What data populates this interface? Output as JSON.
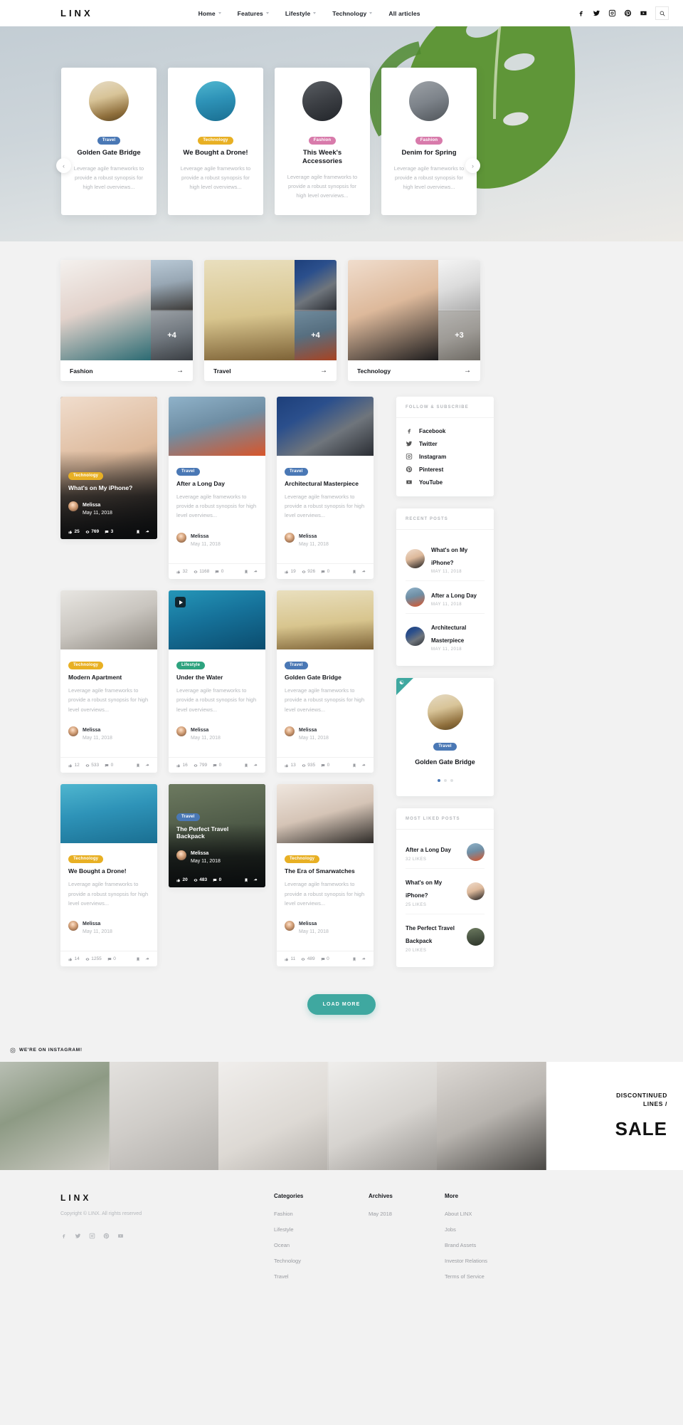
{
  "header": {
    "logo": "LINX",
    "nav": [
      {
        "label": "Home",
        "has_caret": true
      },
      {
        "label": "Features",
        "has_caret": true
      },
      {
        "label": "Lifestyle",
        "has_caret": true
      },
      {
        "label": "Technology",
        "has_caret": true
      },
      {
        "label": "All articles",
        "has_caret": false
      }
    ],
    "social": [
      "facebook-icon",
      "twitter-icon",
      "instagram-icon",
      "pinterest-icon",
      "youtube-icon"
    ],
    "search_icon": "search-icon"
  },
  "hero": {
    "prev_label": "‹",
    "next_label": "›",
    "cards": [
      {
        "tag": "Travel",
        "tag_class": "travel",
        "title": "Golden Gate Bridge",
        "desc": "Leverage agile frameworks to provide a robust synopsis for high level overviews..."
      },
      {
        "tag": "Technology",
        "tag_class": "technology",
        "title": "We Bought a Drone!",
        "desc": "Leverage agile frameworks to provide a robust synopsis for high level overviews..."
      },
      {
        "tag": "Fashion",
        "tag_class": "fashion",
        "title": "This Week's Accessories",
        "desc": "Leverage agile frameworks to provide a robust synopsis for high level overviews..."
      },
      {
        "tag": "Fashion",
        "tag_class": "fashion",
        "title": "Denim for Spring",
        "desc": "Leverage agile frameworks to provide a robust synopsis for high level overviews..."
      }
    ]
  },
  "categories": [
    {
      "name": "Fashion",
      "more": "+4",
      "arrow": "→"
    },
    {
      "name": "Travel",
      "more": "+4",
      "arrow": "→"
    },
    {
      "name": "Technology",
      "more": "+3",
      "arrow": "→"
    }
  ],
  "posts": [
    {
      "tag": "Technology",
      "tag_class": "technology",
      "title": "What's on My iPhone?",
      "desc": "",
      "author": "Melissa",
      "date": "May 11, 2018",
      "likes": "25",
      "views": "769",
      "comments": "3",
      "featured": true
    },
    {
      "tag": "Travel",
      "tag_class": "travel",
      "title": "After a Long Day",
      "desc": "Leverage agile frameworks to provide a robust synopsis for high level overviews...",
      "author": "Melissa",
      "date": "May 11, 2018",
      "likes": "32",
      "views": "1168",
      "comments": "0",
      "featured": false
    },
    {
      "tag": "Travel",
      "tag_class": "travel",
      "title": "Architectural Masterpiece",
      "desc": "Leverage agile frameworks to provide a robust synopsis for high level overviews...",
      "author": "Melissa",
      "date": "May 11, 2018",
      "likes": "19",
      "views": "926",
      "comments": "0",
      "featured": false
    },
    {
      "tag": "Technology",
      "tag_class": "technology",
      "title": "Modern Apartment",
      "desc": "Leverage agile frameworks to provide a robust synopsis for high level overviews...",
      "author": "Melissa",
      "date": "May 11, 2018",
      "likes": "12",
      "views": "533",
      "comments": "0",
      "featured": false
    },
    {
      "tag": "Lifestyle",
      "tag_class": "lifestyle",
      "title": "Under the Water",
      "desc": "Leverage agile frameworks to provide a robust synopsis for high level overviews...",
      "author": "Melissa",
      "date": "May 11, 2018",
      "likes": "16",
      "views": "799",
      "comments": "0",
      "featured": false,
      "video": true
    },
    {
      "tag": "Travel",
      "tag_class": "travel",
      "title": "Golden Gate Bridge",
      "desc": "Leverage agile frameworks to provide a robust synopsis for high level overviews...",
      "author": "Melissa",
      "date": "May 11, 2018",
      "likes": "13",
      "views": "935",
      "comments": "0",
      "featured": false
    },
    {
      "tag": "Technology",
      "tag_class": "technology",
      "title": "We Bought a Drone!",
      "desc": "Leverage agile frameworks to provide a robust synopsis for high level overviews...",
      "author": "Melissa",
      "date": "May 11, 2018",
      "likes": "14",
      "views": "1255",
      "comments": "0",
      "featured": false
    },
    {
      "tag": "Travel",
      "tag_class": "travel",
      "title": "The Perfect Travel Backpack",
      "desc": "",
      "author": "Melissa",
      "date": "May 11, 2018",
      "likes": "20",
      "views": "483",
      "comments": "0",
      "featured": true
    },
    {
      "tag": "Technology",
      "tag_class": "technology",
      "title": "The Era of Smarwatches",
      "desc": "Leverage agile frameworks to provide a robust synopsis for high level overviews...",
      "author": "Melissa",
      "date": "May 11, 2018",
      "likes": "11",
      "views": "489",
      "comments": "0",
      "featured": false
    }
  ],
  "sidebar": {
    "follow": {
      "heading": "FOLLOW & SUBSCRIBE",
      "items": [
        {
          "label": "Facebook",
          "icon": "facebook-icon"
        },
        {
          "label": "Twitter",
          "icon": "twitter-icon"
        },
        {
          "label": "Instagram",
          "icon": "instagram-icon"
        },
        {
          "label": "Pinterest",
          "icon": "pinterest-icon"
        },
        {
          "label": "YouTube",
          "icon": "youtube-icon"
        }
      ]
    },
    "recent": {
      "heading": "RECENT POSTS",
      "items": [
        {
          "title": "What's on My iPhone?",
          "date": "MAY 11, 2018"
        },
        {
          "title": "After a Long Day",
          "date": "MAY 11, 2018"
        },
        {
          "title": "Architectural Masterpiece",
          "date": "MAY 11, 2018"
        }
      ]
    },
    "featured": {
      "tag": "Travel",
      "tag_class": "travel",
      "title": "Golden Gate Bridge",
      "dots": 3,
      "active_dot": 0
    },
    "most_liked": {
      "heading": "MOST LIKED POSTS",
      "items": [
        {
          "title": "After a Long Day",
          "likes": "32 LIKES"
        },
        {
          "title": "What's on My iPhone?",
          "likes": "25 LIKES"
        },
        {
          "title": "The Perfect Travel Backpack",
          "likes": "20 LIKES"
        }
      ]
    }
  },
  "load_more": "LOAD MORE",
  "instagram": {
    "heading": "WE'RE ON INSTAGRAM!",
    "icon": "instagram-icon",
    "sale_line1": "DISCONTINUED",
    "sale_line2": "LINES /",
    "sale_big": "SALE"
  },
  "footer": {
    "logo": "LINX",
    "copyright": "Copyright © LINX. All rights reserved",
    "social": [
      "facebook-icon",
      "twitter-icon",
      "instagram-icon",
      "pinterest-icon",
      "youtube-icon"
    ],
    "columns": [
      {
        "heading": "Categories",
        "links": [
          "Fashion",
          "Lifestyle",
          "Ocean",
          "Technology",
          "Travel"
        ]
      },
      {
        "heading": "Archives",
        "links": [
          "May 2018"
        ]
      },
      {
        "heading": "More",
        "links": [
          "About LINX",
          "Jobs",
          "Brand Assets",
          "Investor Relations",
          "Terms of Service"
        ]
      }
    ]
  },
  "colors": {
    "accent": "#3fa8a0",
    "travel": "#4a78b5",
    "technology": "#e8b024",
    "fashion": "#d87bab",
    "lifestyle": "#2ea37f"
  }
}
